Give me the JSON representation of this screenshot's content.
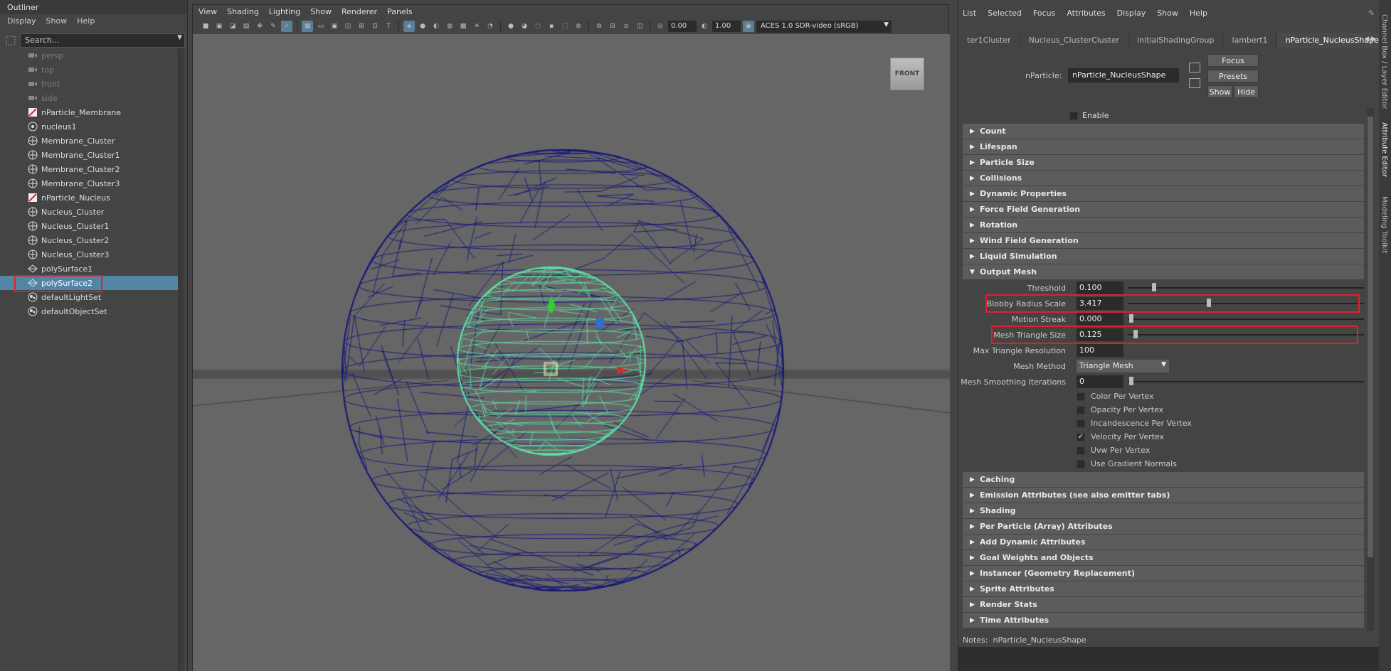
{
  "outliner": {
    "title": "Outliner",
    "menu": [
      "Display",
      "Show",
      "Help"
    ],
    "search_placeholder": "Search...",
    "items": [
      {
        "label": "persp",
        "icon": "camera-icon",
        "dim": true
      },
      {
        "label": "top",
        "icon": "camera-icon",
        "dim": true
      },
      {
        "label": "front",
        "icon": "camera-icon",
        "dim": true
      },
      {
        "label": "side",
        "icon": "camera-icon",
        "dim": true
      },
      {
        "label": "nParticle_Membrane",
        "icon": "nparticle-icon"
      },
      {
        "label": "nucleus1",
        "icon": "nucleus-icon"
      },
      {
        "label": "Membrane_Cluster",
        "icon": "cluster-icon"
      },
      {
        "label": "Membrane_Cluster1",
        "icon": "cluster-icon"
      },
      {
        "label": "Membrane_Cluster2",
        "icon": "cluster-icon"
      },
      {
        "label": "Membrane_Cluster3",
        "icon": "cluster-icon"
      },
      {
        "label": "nParticle_Nucleus",
        "icon": "nparticle-icon"
      },
      {
        "label": "Nucleus_Cluster",
        "icon": "cluster-icon"
      },
      {
        "label": "Nucleus_Cluster1",
        "icon": "cluster-icon"
      },
      {
        "label": "Nucleus_Cluster2",
        "icon": "cluster-icon"
      },
      {
        "label": "Nucleus_Cluster3",
        "icon": "cluster-icon"
      },
      {
        "label": "polySurface1",
        "icon": "polysurface-icon"
      },
      {
        "label": "polySurface2",
        "icon": "polysurface-icon",
        "selected": true
      },
      {
        "label": "defaultLightSet",
        "icon": "set-icon"
      },
      {
        "label": "defaultObjectSet",
        "icon": "set-icon"
      }
    ]
  },
  "viewport": {
    "menu": [
      "View",
      "Shading",
      "Lighting",
      "Show",
      "Renderer",
      "Panels"
    ],
    "exposure": "0.00",
    "gamma": "1.00",
    "color_space": "ACES 1.0 SDR-video (sRGB)",
    "view_cube": "FRONT",
    "colors": {
      "outer_mesh": "#15157a",
      "inner_mesh": "#5ee8a8",
      "background": "#666666"
    }
  },
  "attr": {
    "menu": [
      "List",
      "Selected",
      "Focus",
      "Attributes",
      "Display",
      "Show",
      "Help"
    ],
    "tabs": [
      "ter1Cluster",
      "Nucleus_ClusterCluster",
      "initialShadingGroup",
      "lambert1",
      "nParticle_NucleusShape"
    ],
    "node_label": "nParticle:",
    "node_name": "nParticle_NucleusShape",
    "buttons": {
      "focus": "Focus",
      "presets": "Presets",
      "show": "Show",
      "hide": "Hide"
    },
    "enable_label": "Enable",
    "sections_top": [
      "Count",
      "Lifespan",
      "Particle Size",
      "Collisions",
      "Dynamic Properties",
      "Force Field Generation",
      "Rotation",
      "Wind Field Generation",
      "Liquid Simulation"
    ],
    "output_mesh": {
      "title": "Output Mesh",
      "threshold": {
        "label": "Threshold",
        "value": "0.100",
        "level": 0.1
      },
      "blobby": {
        "label": "Blobby Radius Scale",
        "value": "3.417",
        "level": 0.34
      },
      "motion": {
        "label": "Motion Streak",
        "value": "0.000",
        "level": 0.0
      },
      "tri_size": {
        "label": "Mesh Triangle Size",
        "value": "0.125",
        "level": 0.02
      },
      "max_res": {
        "label": "Max Triangle Resolution",
        "value": "100"
      },
      "method": {
        "label": "Mesh Method",
        "value": "Triangle Mesh"
      },
      "smoothing": {
        "label": "Mesh Smoothing Iterations",
        "value": "0",
        "level": 0.0
      },
      "checks": [
        {
          "label": "Color Per Vertex",
          "checked": false
        },
        {
          "label": "Opacity Per Vertex",
          "checked": false
        },
        {
          "label": "Incandescence Per Vertex",
          "checked": false
        },
        {
          "label": "Velocity Per Vertex",
          "checked": true
        },
        {
          "label": "Uvw Per Vertex",
          "checked": false
        },
        {
          "label": "Use Gradient Normals",
          "checked": false
        }
      ]
    },
    "sections_bottom": [
      "Caching",
      "Emission Attributes (see also emitter tabs)",
      "Shading",
      "Per Particle (Array) Attributes",
      "Add Dynamic Attributes",
      "Goal Weights and Objects",
      "Instancer (Geometry Replacement)",
      "Sprite Attributes",
      "Render Stats",
      "Time Attributes"
    ],
    "notes_label": "Notes:",
    "notes_value": "nParticle_NucleusShape",
    "side_tabs": [
      "Channel Box / Layer Editor",
      "Attribute Editor",
      "Modeling Toolkit"
    ]
  }
}
